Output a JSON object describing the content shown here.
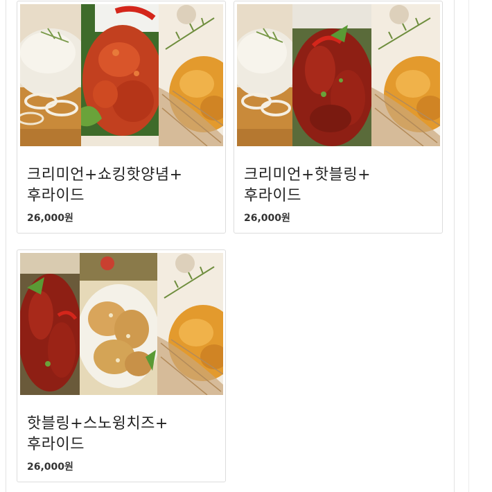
{
  "menu": {
    "items": [
      {
        "name_line1": "크리미언+쇼킹핫양념+",
        "name_line2": "후라이드",
        "price": "26,000원",
        "image_icon": "chicken-combo-photo",
        "panels": [
          "creamy-onion",
          "shocking-hot-yangnyeom",
          "fried"
        ]
      },
      {
        "name_line1": "크리미언+핫블링+",
        "name_line2": "후라이드",
        "price": "26,000원",
        "image_icon": "chicken-combo-photo",
        "panels": [
          "creamy-onion",
          "hot-bling",
          "fried"
        ]
      },
      {
        "name_line1": "핫블링+스노윙치즈+",
        "name_line2": "후라이드",
        "price": "26,000원",
        "image_icon": "chicken-combo-photo",
        "panels": [
          "hot-bling",
          "snowing-cheese",
          "fried"
        ]
      }
    ]
  },
  "colors": {
    "border": "#dcdcdc",
    "title": "#222222",
    "price": "#333333",
    "fried": "#e39a2d",
    "sauced": "#b8321f",
    "creamy": "#ece8dc",
    "cheese": "#d9a55b"
  }
}
